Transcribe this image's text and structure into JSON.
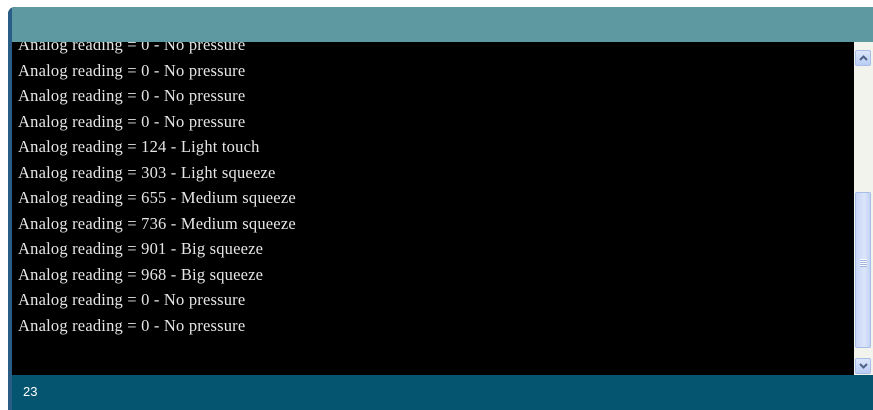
{
  "console": {
    "lines": [
      "Analog reading = 0 - No pressure",
      "Analog reading = 0 - No pressure",
      "Analog reading = 0 - No pressure",
      "Analog reading = 0 - No pressure",
      "Analog reading = 124 - Light touch",
      "Analog reading = 303 - Light squeeze",
      "Analog reading = 655 - Medium squeeze",
      "Analog reading = 736 - Medium squeeze",
      "Analog reading = 901 - Big squeeze",
      "Analog reading = 968 - Big squeeze",
      "Analog reading = 0 - No pressure",
      "Analog reading = 0 - No pressure"
    ]
  },
  "scrollbar": {
    "up_icon": "chevron-up-icon",
    "down_icon": "chevron-down-icon",
    "grip_icon": "grip-icon"
  },
  "status": {
    "line_number": "23"
  },
  "colors": {
    "topbar": "#5e98a0",
    "statusbar": "#055570",
    "console_bg": "#000000",
    "console_text": "#e6e6e6",
    "scroll_track": "#f3f3ee",
    "scroll_thumb": "#c8d6f6"
  }
}
